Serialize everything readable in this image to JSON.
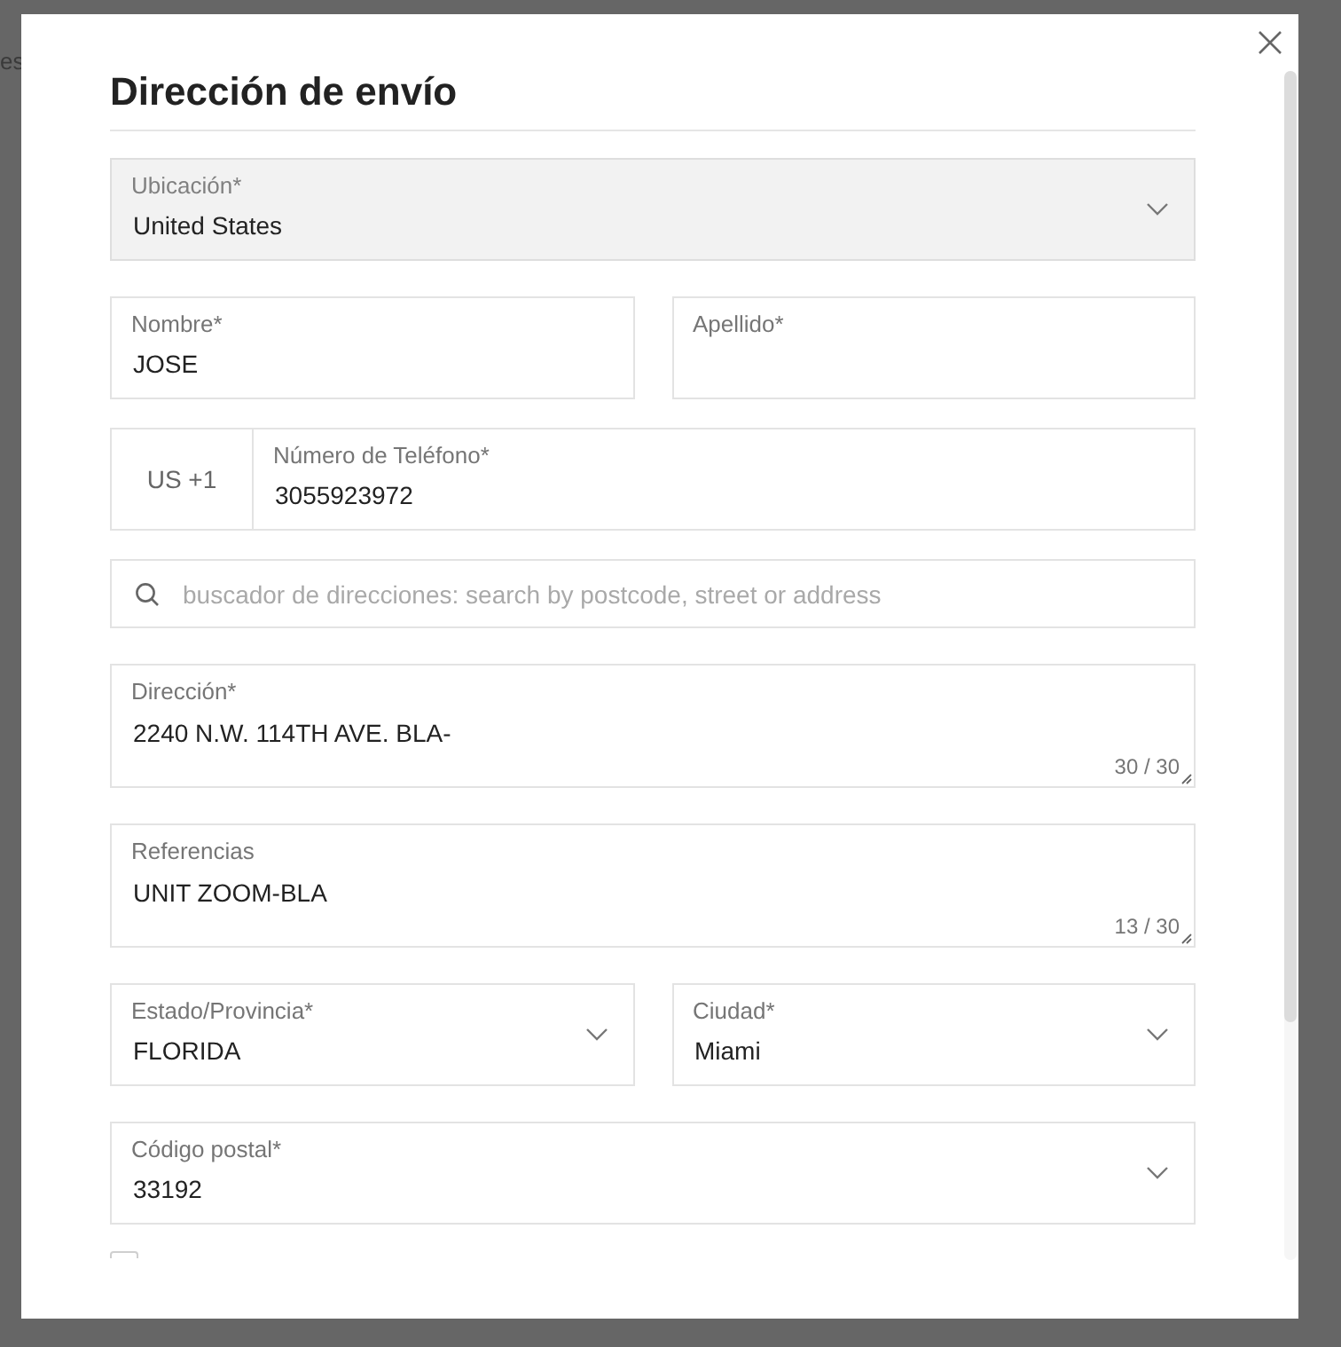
{
  "backdrop": {
    "text": "es"
  },
  "dialog": {
    "title": "Dirección de envío"
  },
  "rows": [
    {
      "fields": [
        {
          "kind": "select",
          "label": "Ubicación*",
          "value": "United States",
          "disabled": true
        }
      ]
    },
    {
      "fields": [
        {
          "kind": "text",
          "label": "Nombre*",
          "value": "JOSE",
          "disabled": false
        },
        {
          "kind": "text",
          "label": "Apellido*",
          "disabled": false
        }
      ]
    },
    {
      "fields": [
        {
          "kind": "phone",
          "prefix": "US +1",
          "label": "Número de Teléfono*",
          "value": "3055923972",
          "disabled": false
        }
      ]
    },
    {
      "fields": [
        {
          "kind": "search",
          "placeholder": "buscador de direcciones: search by postcode, street or address",
          "disabled": false
        }
      ]
    },
    {
      "fields": [
        {
          "kind": "textarea",
          "label": "Dirección*",
          "value": "2240 N.W. 114TH AVE. BLA-",
          "counter": "30 / 30",
          "disabled": false
        }
      ]
    },
    {
      "fields": [
        {
          "kind": "textarea",
          "label": "Referencias",
          "value": "UNIT ZOOM-BLA",
          "counter": "13 / 30",
          "disabled": false
        }
      ]
    },
    {
      "fields": [
        {
          "kind": "select",
          "label": "Estado/Provincia*",
          "value": "FLORIDA",
          "disabled": false
        },
        {
          "kind": "select",
          "label": "Ciudad*",
          "value": "Miami",
          "disabled": false
        }
      ]
    },
    {
      "fields": [
        {
          "kind": "select",
          "label": "Código postal*",
          "value": "33192",
          "disabled": false
        }
      ]
    }
  ],
  "checkbox": {
    "checked": false
  }
}
